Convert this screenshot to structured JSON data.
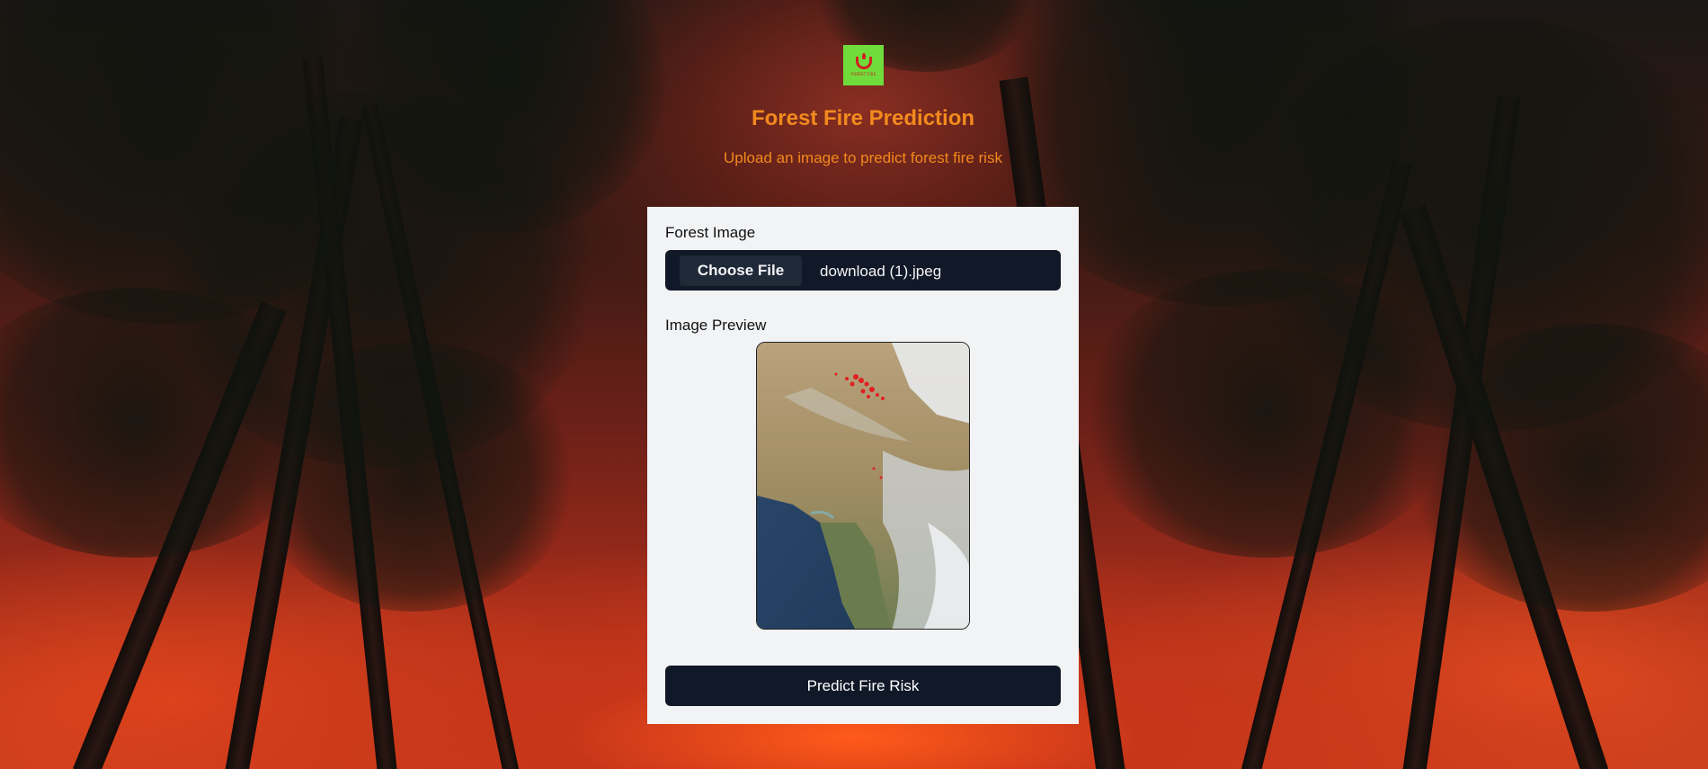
{
  "header": {
    "logo_text": "FOREST FIRE",
    "title": "Forest Fire Prediction",
    "subtitle": "Upload an image to predict forest fire risk"
  },
  "form": {
    "image_label": "Forest Image",
    "choose_file_label": "Choose File",
    "file_name": "download (1).jpeg",
    "preview_label": "Image Preview",
    "predict_label": "Predict Fire Risk"
  },
  "colors": {
    "accent": "#f28a1e",
    "card_bg": "#f2f3f5",
    "button_bg": "#111827",
    "logo_bg": "#6fdc3c"
  },
  "icons": {
    "logo": "fire-logo-icon"
  }
}
